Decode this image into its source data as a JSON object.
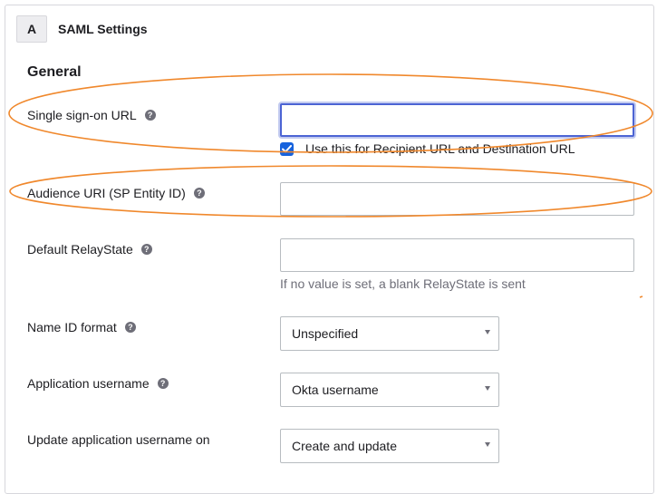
{
  "section": {
    "step": "A",
    "title": "SAML Settings"
  },
  "general": {
    "heading": "General"
  },
  "fields": {
    "sso_url": {
      "label": "Single sign-on URL",
      "value": ""
    },
    "recipient_checkbox": {
      "label": "Use this for Recipient URL and Destination URL",
      "checked": true
    },
    "audience_uri": {
      "label": "Audience URI (SP Entity ID)",
      "value": ""
    },
    "relay_state": {
      "label": "Default RelayState",
      "value": "",
      "hint": "If no value is set, a blank RelayState is sent"
    },
    "name_id_format": {
      "label": "Name ID format",
      "selected": "Unspecified"
    },
    "app_username": {
      "label": "Application username",
      "selected": "Okta username"
    },
    "update_username_on": {
      "label": "Update application username on",
      "selected": "Create and update"
    }
  },
  "help_glyph": "?",
  "colors": {
    "accent": "#1662dd",
    "focus_ring": "#4c64d4",
    "annotation": "#f0882c"
  }
}
